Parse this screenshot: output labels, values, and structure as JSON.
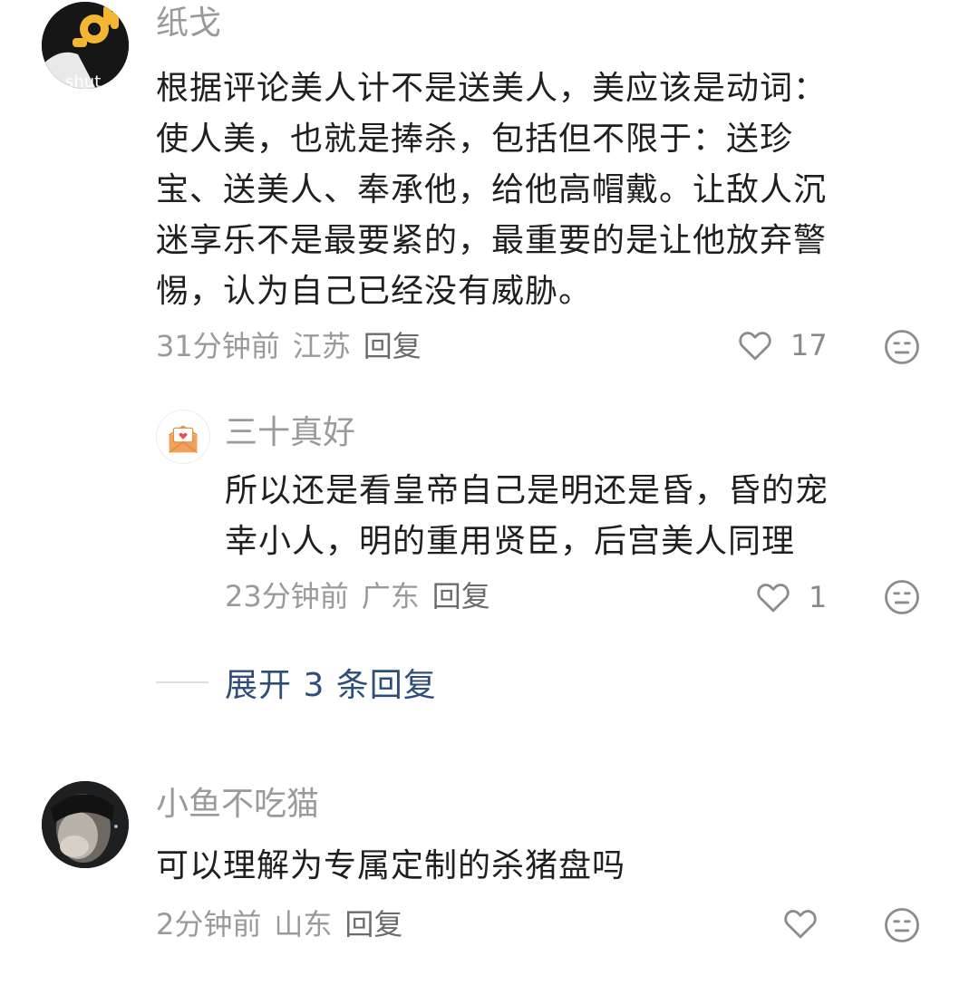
{
  "comments": [
    {
      "username": "纸戈",
      "avatar_badge": "shut",
      "body_lines": [
        "根据评论美人计不是送美人，美应该是动词：",
        "使人美，也就是捧杀，包括但不限于：送珍",
        "宝、送美人、奉承他，给他高帽戴。让敌人沉",
        "迷享乐不是最要紧的，最重要的是让他放弃警",
        "惕，认为自己已经没有威胁。"
      ],
      "time": "31分钟前",
      "location": "江苏",
      "reply_label": "回复",
      "likes": "17",
      "icons": {
        "like": "heart-outline-icon",
        "dislike": "meh-face-icon"
      }
    },
    {
      "username": "三十真好",
      "body_lines": [
        "所以还是看皇帝自己是明还是昏，昏的宠",
        "幸小人，明的重用贤臣，后宫美人同理"
      ],
      "time": "23分钟前",
      "location": "广东",
      "reply_label": "回复",
      "likes": "1",
      "icons": {
        "like": "heart-outline-icon",
        "dislike": "meh-face-icon"
      }
    },
    {
      "username": "小鱼不吃猫",
      "body_lines": [
        "可以理解为专属定制的杀猪盘吗"
      ],
      "time": "2分钟前",
      "location": "山东",
      "reply_label": "回复",
      "icons": {
        "like": "heart-outline-icon",
        "dislike": "meh-face-icon"
      }
    }
  ],
  "expand_replies_label": "展开 3 条回复",
  "colors": {
    "username": "#9a9a9a",
    "body": "#1f1f1f",
    "meta": "#9a9a9a",
    "expand_link": "#2f4d7a",
    "icon_stroke": "#8c8c8c"
  }
}
